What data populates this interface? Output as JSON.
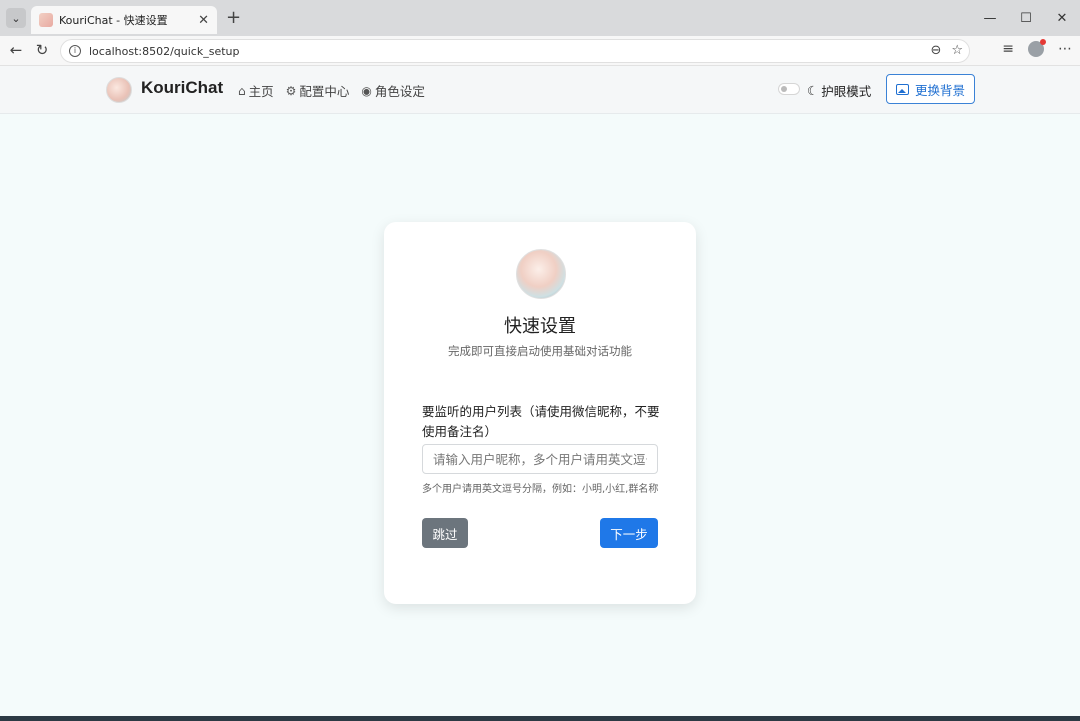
{
  "browser": {
    "tab_title": "KouriChat - 快速设置",
    "url": "localhost:8502/quick_setup",
    "icons": {
      "tab_list": "chevron-down-icon",
      "new_tab": "plus-icon",
      "back": "back-arrow-icon",
      "reload": "reload-icon",
      "minimize": "minimize-icon",
      "maximize": "maximize-icon",
      "close": "close-icon"
    }
  },
  "navbar": {
    "brand": "KouriChat",
    "links": [
      {
        "label": "主页",
        "icon": "home-icon"
      },
      {
        "label": "配置中心",
        "icon": "gear-icon"
      },
      {
        "label": "角色设定",
        "icon": "user-circle-icon"
      }
    ],
    "eye_mode_label": "护眼模式",
    "change_bg_label": "更换背景"
  },
  "card": {
    "title": "快速设置",
    "subtitle": "完成即可直接启动使用基础对话功能",
    "field_label": "要监听的用户列表（请使用微信昵称，不要使用备注名）",
    "field_placeholder": "请输入用户昵称，多个用户请用英文逗号分隔",
    "field_help": "多个用户请用英文逗号分隔，例如：小明,小红,群名称",
    "skip_label": "跳过",
    "next_label": "下一步"
  },
  "colors": {
    "primary": "#1f78e8",
    "secondary": "#6c757d",
    "page_bg": "#f4fbfb"
  }
}
